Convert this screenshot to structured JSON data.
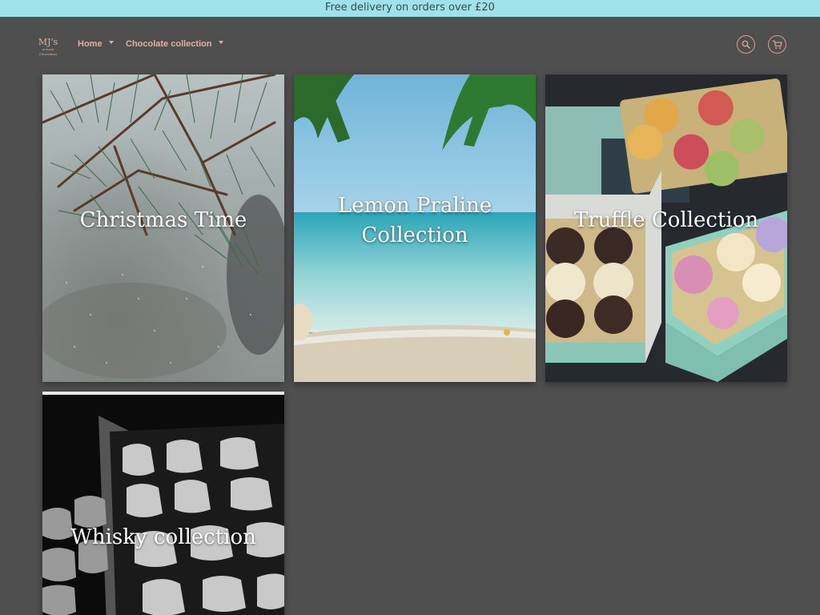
{
  "announcement": {
    "text": "Free delivery on orders over £20"
  },
  "header": {
    "logo": {
      "title": "MJ's",
      "subtitle": "Artisan Chocolates"
    },
    "nav": [
      {
        "label": "Home",
        "has_dropdown": true
      },
      {
        "label": "Chocolate collection",
        "has_dropdown": true
      }
    ],
    "icons": [
      "search-icon",
      "cart-icon"
    ]
  },
  "collections": [
    {
      "title": "Christmas Time"
    },
    {
      "title": "Lemon Praline Collection",
      "title_line1": "Lemon Praline",
      "title_line2": "Collection"
    },
    {
      "title": "Truffle Collection"
    },
    {
      "title": "Whisky collection"
    }
  ],
  "colors": {
    "announcement_bg": "#9ee2ea",
    "page_bg": "#4f4f4f",
    "accent": "#e0b0a0"
  }
}
